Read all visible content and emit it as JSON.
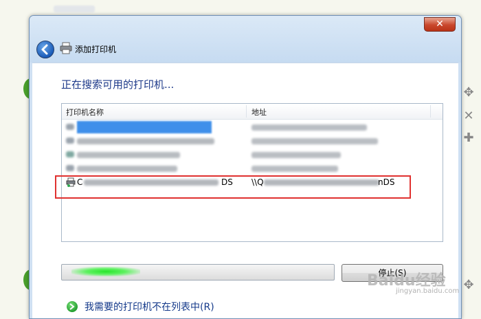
{
  "window": {
    "title": "添加打印机",
    "close_label": "✕"
  },
  "content": {
    "heading": "正在搜索可用的打印机...",
    "list": {
      "columns": [
        "打印机名称",
        "地址"
      ],
      "highlighted_row": {
        "name_prefix": "C",
        "name_suffix": "DS",
        "address_prefix": "\\\\Q",
        "address_suffix": "nDS"
      }
    },
    "stop_button": "停止(S)",
    "missing_printer_link": "我需要的打印机不在列表中(R)"
  },
  "watermark": {
    "logo": "Baidu经验",
    "url": "jingyan.baidu.com"
  },
  "colors": {
    "heading": "#1e3a8a",
    "highlight_border": "#e0312f",
    "progress": "#29e52c",
    "close": "#c9462c"
  }
}
